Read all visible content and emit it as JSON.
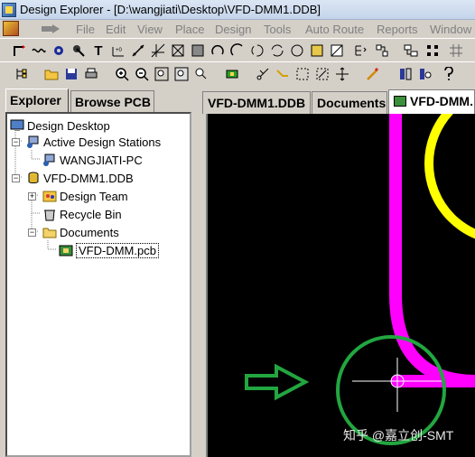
{
  "window": {
    "title": "Design Explorer - [D:\\wangjiati\\Desktop\\VFD-DMM1.DDB]"
  },
  "menu": [
    "File",
    "Edit",
    "View",
    "Place",
    "Design",
    "Tools",
    "Auto Route",
    "Reports",
    "Window"
  ],
  "explorer": {
    "tabs": [
      "Explorer",
      "Browse PCB"
    ],
    "tree": [
      {
        "label": "Design Desktop"
      },
      {
        "label": "Active Design Stations"
      },
      {
        "label": "WANGJIATI-PC"
      },
      {
        "label": "VFD-DMM1.DDB"
      },
      {
        "label": "Design Team"
      },
      {
        "label": "Recycle Bin"
      },
      {
        "label": "Documents"
      },
      {
        "label": "VFD-DMM.pcb"
      }
    ]
  },
  "doc_tabs": [
    "VFD-DMM1.DDB",
    "Documents",
    "VFD-DMM."
  ],
  "watermark": {
    "text": "知乎 @嘉立创-SMT"
  },
  "colors": {
    "trace_magenta": "#ff00ff",
    "trace_yellow": "#ffff00",
    "highlight_circle": "#22a640",
    "arrow": "#22a640"
  }
}
